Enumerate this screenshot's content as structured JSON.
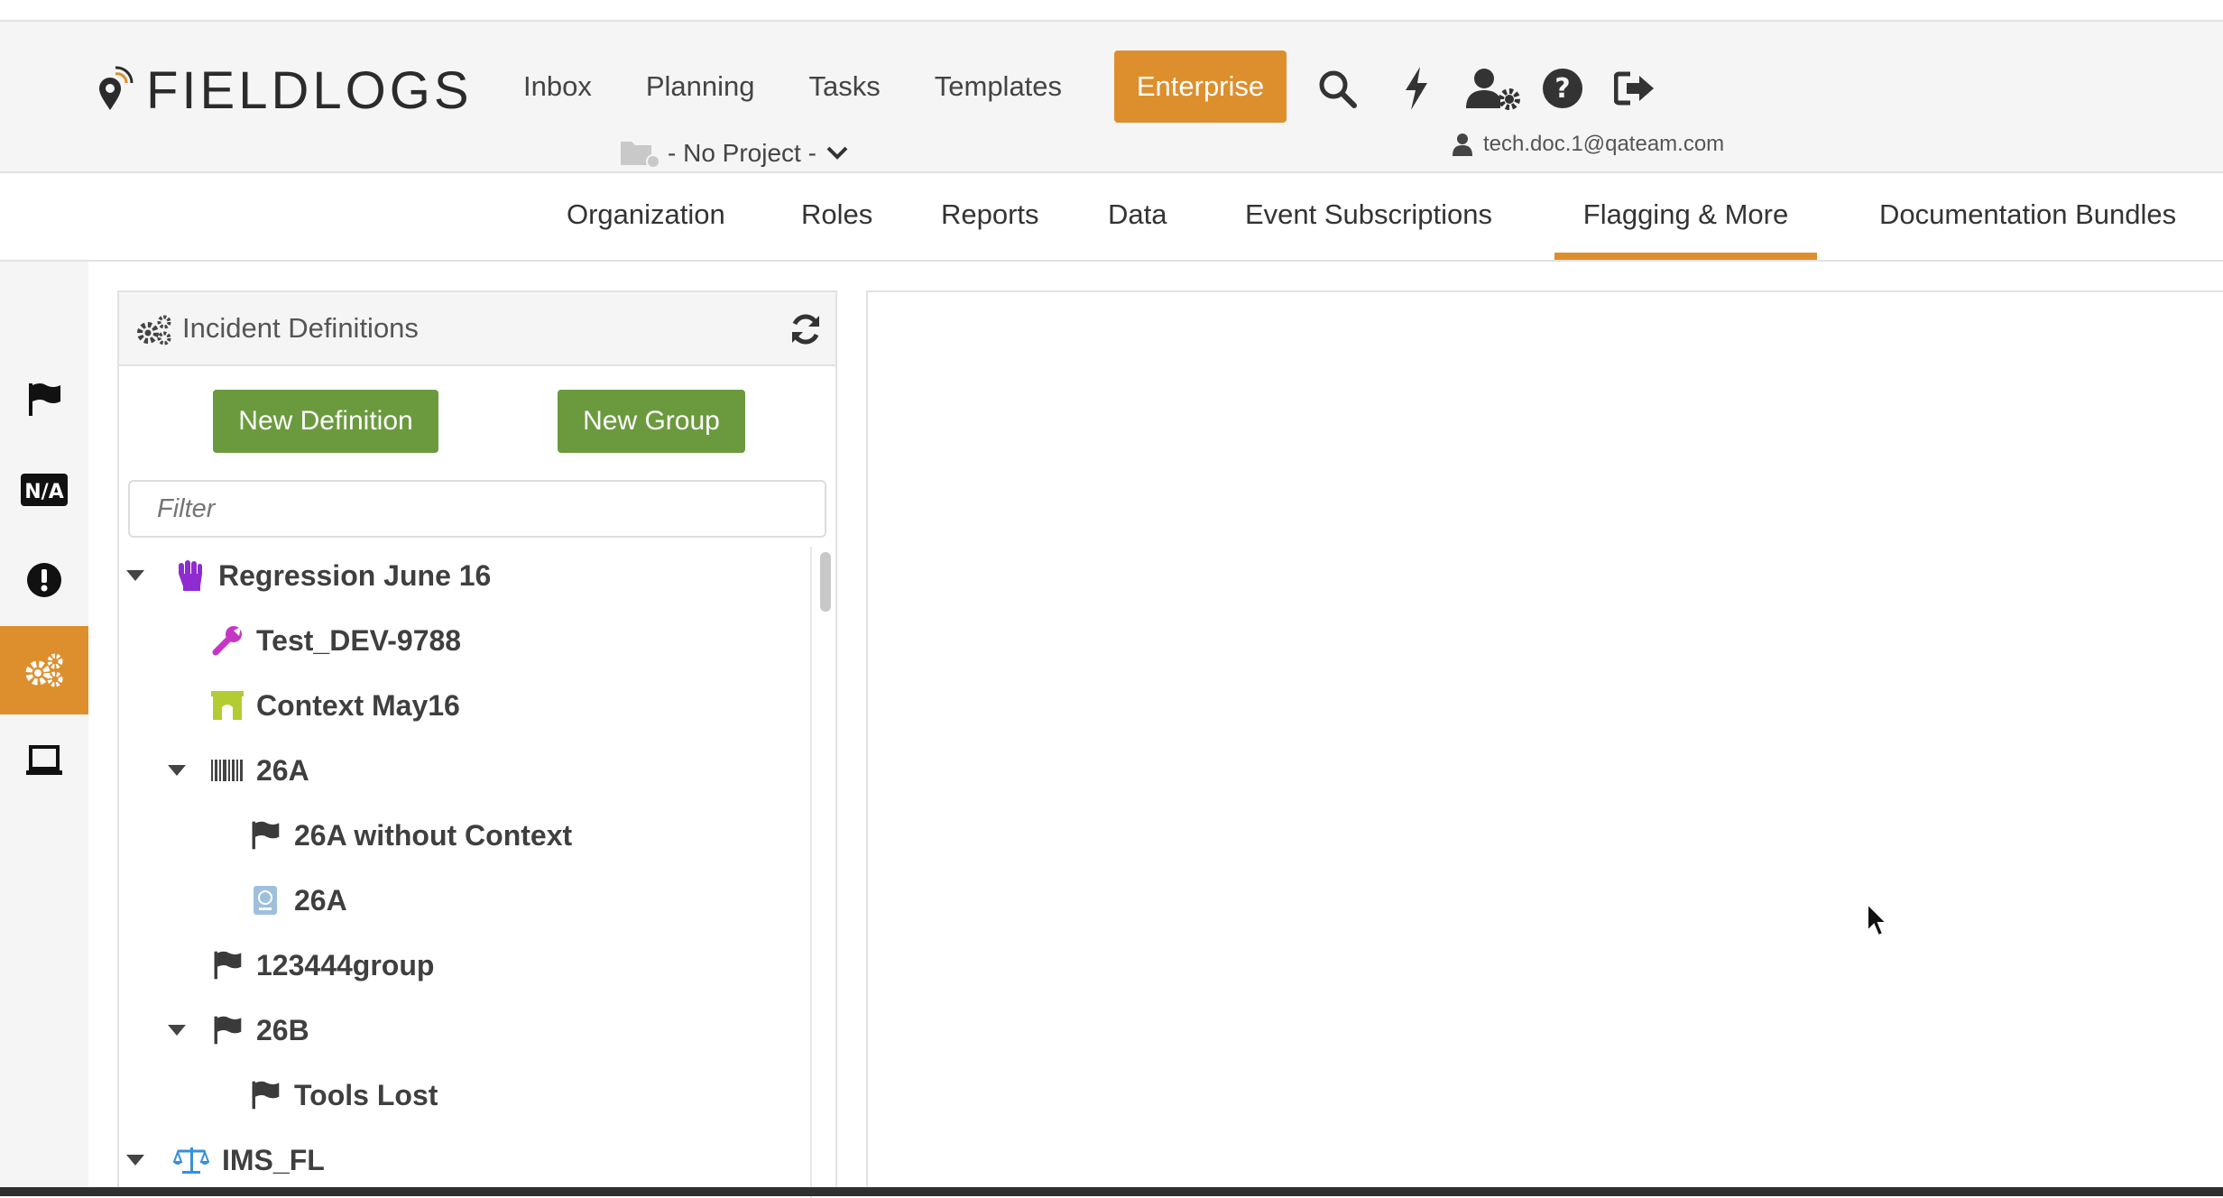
{
  "app": {
    "logo_text": "FIELDLOGS"
  },
  "nav": {
    "items": [
      "Inbox",
      "Planning",
      "Tasks",
      "Templates"
    ],
    "enterprise": "Enterprise"
  },
  "project": {
    "label": "- No Project -"
  },
  "user": {
    "email": "tech.doc.1@qateam.com"
  },
  "subnav": {
    "items": [
      "Organization",
      "Roles",
      "Reports",
      "Data",
      "Event Subscriptions",
      "Flagging & More",
      "Documentation Bundles"
    ],
    "active": "Flagging & More"
  },
  "sidebar": {
    "icons": [
      "flag-icon",
      "na-icon",
      "exclamation-circle-icon",
      "cogs-icon",
      "laptop-icon"
    ],
    "active": "cogs-icon"
  },
  "panel": {
    "title": "Incident Definitions",
    "new_definition": "New Definition",
    "new_group": "New Group",
    "filter_placeholder": "Filter"
  },
  "tree": [
    {
      "label": "Regression June 16",
      "icon": "fist-icon",
      "icon_color": "#8e2bd1",
      "expanded": true
    },
    {
      "label": "Test_DEV-9788",
      "icon": "wrench-icon",
      "icon_color": "#c636c6"
    },
    {
      "label": "Context May16",
      "icon": "archway-icon",
      "icon_color": "#b4cc33"
    },
    {
      "label": "26A",
      "icon": "barcode-icon",
      "icon_color": "#444444",
      "expanded": true
    },
    {
      "label": "26A without Context",
      "icon": "flag-icon",
      "icon_color": "#3a3a3a"
    },
    {
      "label": "26A",
      "icon": "passport-icon",
      "icon_color": "#9fc0dc"
    },
    {
      "label": "123444group",
      "icon": "flag-icon",
      "icon_color": "#3a3a3a"
    },
    {
      "label": "26B",
      "icon": "flag-icon",
      "icon_color": "#3a3a3a",
      "expanded": true
    },
    {
      "label": "Tools Lost",
      "icon": "flag-icon",
      "icon_color": "#3a3a3a"
    },
    {
      "label": "IMS_FL",
      "icon": "balance-scale-icon",
      "icon_color": "#3a8fd6",
      "expanded": true
    }
  ],
  "colors": {
    "accent": "#dd8f2d",
    "button_green": "#6b9a3e"
  }
}
